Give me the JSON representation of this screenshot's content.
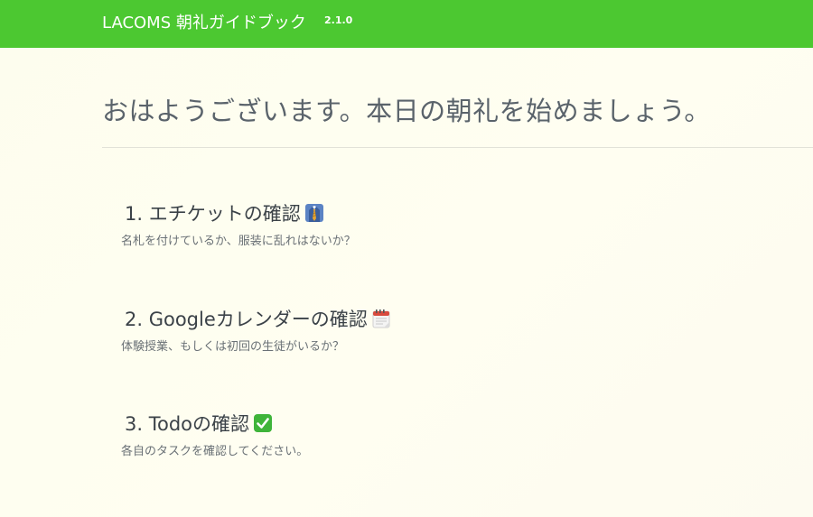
{
  "header": {
    "title": "LACOMS 朝礼ガイドブック",
    "version": "2.1.0",
    "background": "#4cc831"
  },
  "greeting": "おはようございます。本日の朝礼を始めましょう。",
  "items": [
    {
      "title": "1. エチケットの確認",
      "icon": "necktie-icon",
      "description": "名札を付けているか、服装に乱れはないか？"
    },
    {
      "title": "2. Googleカレンダーの確認",
      "icon": "calendar-icon",
      "description": "体験授業、もしくは初回の生徒がいるか？"
    },
    {
      "title": "3. Todoの確認",
      "icon": "check-mark-icon",
      "description": "各自のタスクを確認してください。"
    }
  ]
}
